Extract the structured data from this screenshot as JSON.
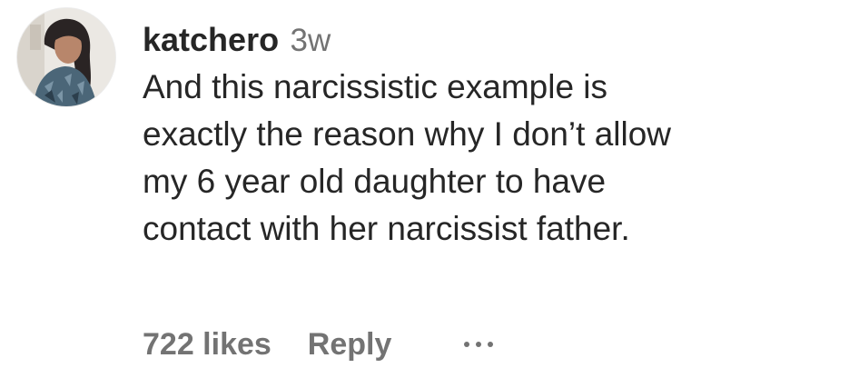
{
  "comment": {
    "username": "katchero",
    "timestamp": "3w",
    "text": "And this narcissistic example is\nexactly the reason why I don’t allow\nmy 6 year old daughter to have\ncontact with her narcissist father.",
    "likes": "722 likes",
    "reply_label": "Reply",
    "avatar_icon": "user-avatar-photo",
    "more_icon": "more-options-icon"
  },
  "colors": {
    "primary_text": "#262626",
    "secondary_text": "#737373",
    "background": "#ffffff"
  }
}
